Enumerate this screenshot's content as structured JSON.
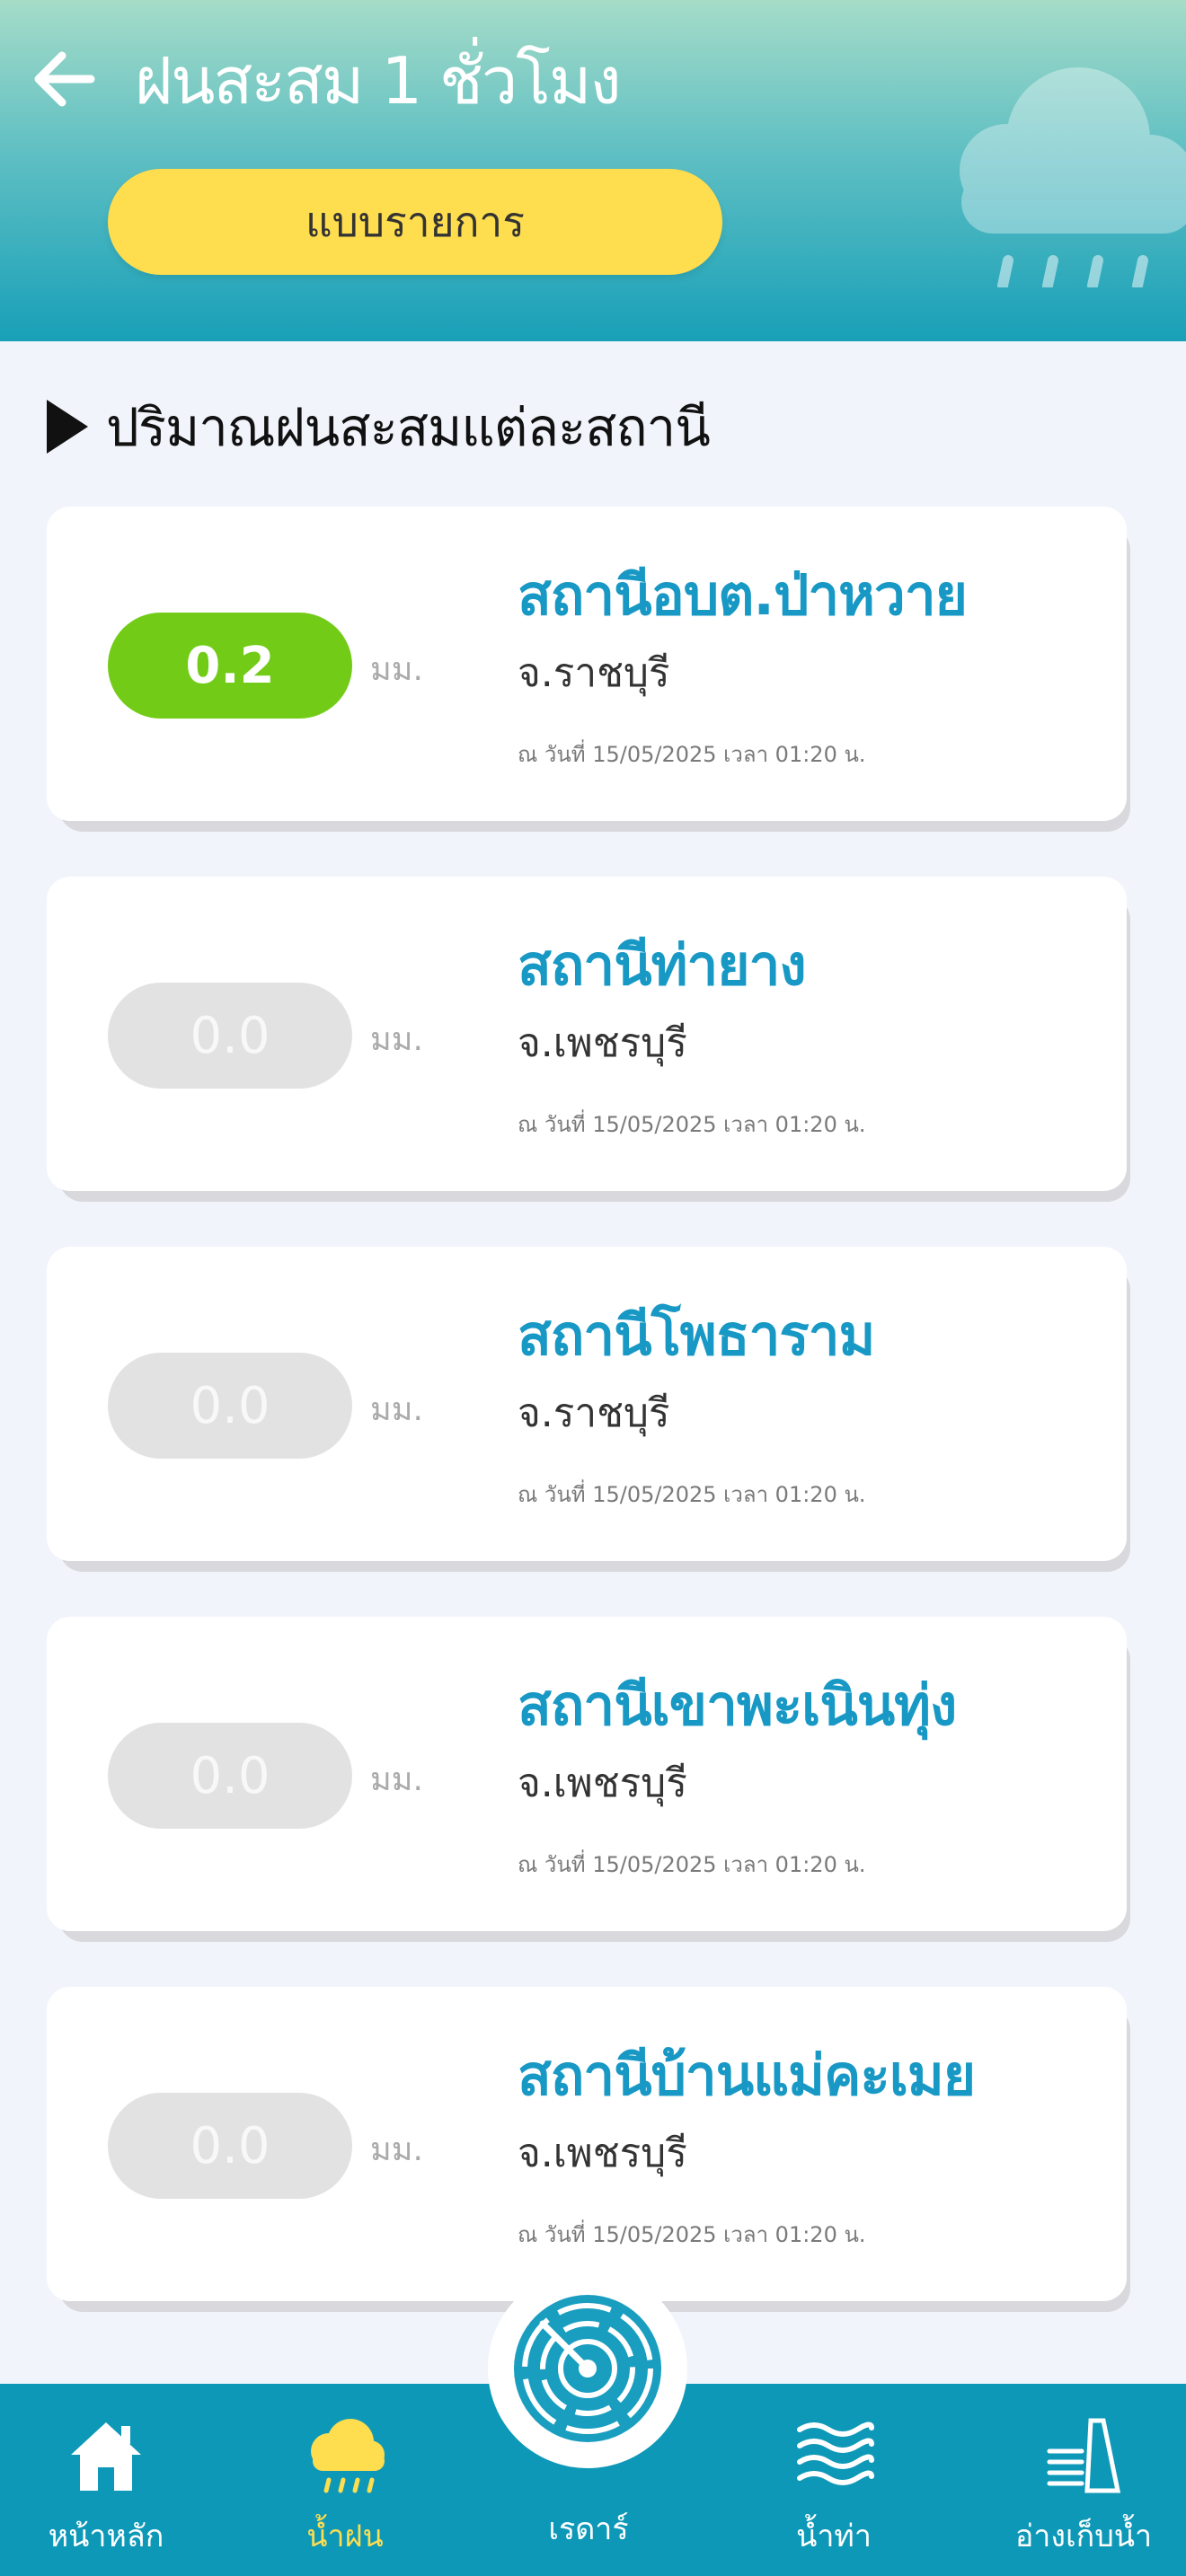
{
  "header": {
    "title": "ฝนสะสม 1 ชั่วโมง",
    "view_button": "แบบรายการ"
  },
  "section_title": "ปริมาณฝนสะสมแต่ละสถานี",
  "stations": [
    {
      "value": "0.2",
      "unit": "มม.",
      "name": "สถานีอบต.ป่าหวาย",
      "province": "จ.ราชบุรี",
      "time": "ณ วันที่ 15/05/2025 เวลา 01:20 น.",
      "status": "active"
    },
    {
      "value": "0.0",
      "unit": "มม.",
      "name": "สถานีท่ายาง",
      "province": "จ.เพชรบุรี",
      "time": "ณ วันที่ 15/05/2025 เวลา 01:20 น.",
      "status": "zero"
    },
    {
      "value": "0.0",
      "unit": "มม.",
      "name": "สถานีโพธาราม",
      "province": "จ.ราชบุรี",
      "time": "ณ วันที่ 15/05/2025 เวลา 01:20 น.",
      "status": "zero"
    },
    {
      "value": "0.0",
      "unit": "มม.",
      "name": "สถานีเขาพะเนินทุ่ง",
      "province": "จ.เพชรบุรี",
      "time": "ณ วันที่ 15/05/2025 เวลา 01:20 น.",
      "status": "zero"
    },
    {
      "value": "0.0",
      "unit": "มม.",
      "name": "สถานีบ้านแม่คะเมย",
      "province": "จ.เพชรบุรี",
      "time": "ณ วันที่ 15/05/2025 เวลา 01:20 น.",
      "status": "zero"
    }
  ],
  "nav": {
    "home": "หน้าหลัก",
    "rain": "น้ำฝน",
    "radar": "เรดาร์",
    "runoff": "น้ำท่า",
    "reservoir": "อ่างเก็บน้ำ"
  },
  "colors": {
    "accent": "#1898c4",
    "active_pill": "#72cc17",
    "zero_pill": "#e2e2e2",
    "button_yellow": "#fedd4e",
    "nav_bg": "#0e98b8"
  }
}
